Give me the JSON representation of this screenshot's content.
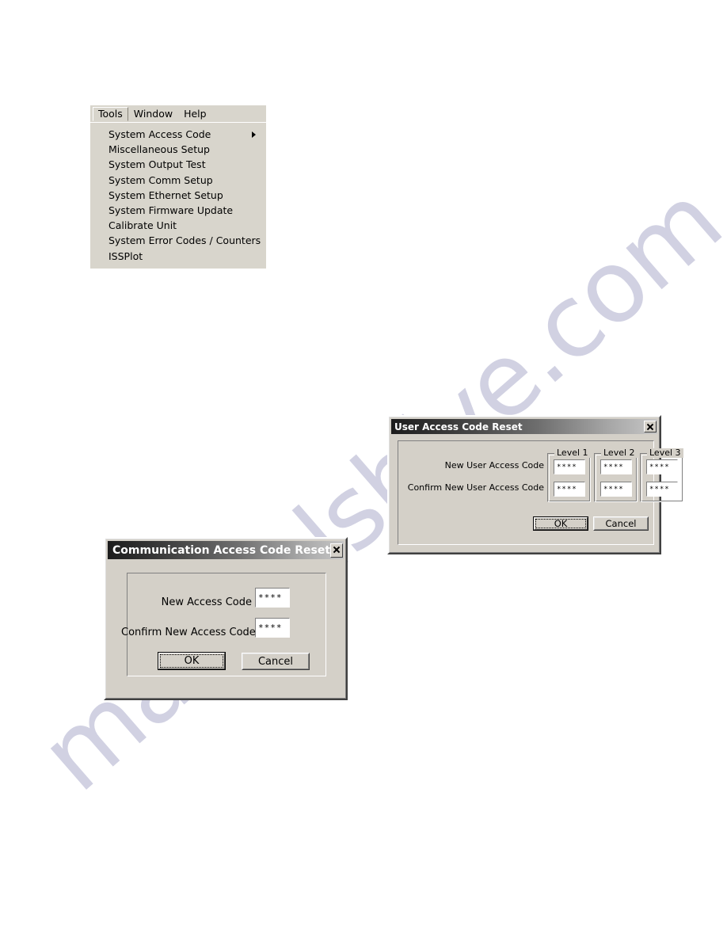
{
  "page": {
    "background_color": "#ffffff",
    "watermark_text": "manualshive.com",
    "watermark_color": "#c9cade"
  },
  "menu": {
    "name": "tools-menu",
    "menubar": [
      {
        "label": "Tools",
        "open": true
      },
      {
        "label": "Window",
        "open": false
      },
      {
        "label": "Help",
        "open": false
      }
    ],
    "items": [
      {
        "label": "System Access Code",
        "submenu": true
      },
      {
        "label": "Miscellaneous Setup",
        "submenu": false
      },
      {
        "label": "System Output Test",
        "submenu": false
      },
      {
        "label": "System Comm Setup",
        "submenu": false
      },
      {
        "label": "System Ethernet Setup",
        "submenu": false
      },
      {
        "label": "System Firmware Update",
        "submenu": false
      },
      {
        "label": "Calibrate Unit",
        "submenu": false
      },
      {
        "label": "System Error Codes / Counters",
        "submenu": false
      },
      {
        "label": "ISSPlot",
        "submenu": false
      }
    ]
  },
  "user_dialog": {
    "title": "User Access Code Reset",
    "close_icon": "close-icon",
    "row_labels": [
      "New User Access Code",
      "Confirm New User Access Code"
    ],
    "levels": [
      {
        "title": "Level 1",
        "new_value": "****",
        "confirm_value": "****"
      },
      {
        "title": "Level 2",
        "new_value": "****",
        "confirm_value": "****"
      },
      {
        "title": "Level 3",
        "new_value": "****",
        "confirm_value": "****"
      }
    ],
    "ok_label": "OK",
    "cancel_label": "Cancel"
  },
  "comm_dialog": {
    "title": "Communication Access Code Reset",
    "close_icon": "close-icon",
    "rows": [
      {
        "label": "New Access Code",
        "value": "****"
      },
      {
        "label": "Confirm New Access Code",
        "value": "****"
      }
    ],
    "ok_label": "OK",
    "cancel_label": "Cancel"
  }
}
